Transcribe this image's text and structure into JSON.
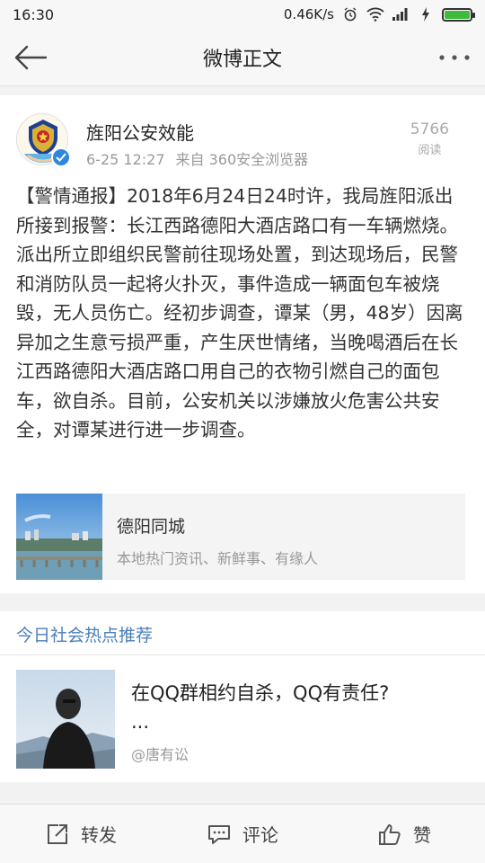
{
  "status_bar": {
    "time": "16:30",
    "net_speed": "0.46K/s",
    "battery_level": 1.0
  },
  "header": {
    "title": "微博正文"
  },
  "post": {
    "author": "旌阳公安效能",
    "date": "6-25 12:27",
    "source": "来自 360安全浏览器",
    "read_count": "5766",
    "read_label": "阅读",
    "text": "【警情通报】2018年6月24日24时许，我局旌阳派出所接到报警：长江西路德阳大酒店路口有一车辆燃烧。派出所立即组织民警前往现场处置，到达现场后，民警和消防队员一起将火扑灭，事件造成一辆面包车被烧毁，无人员伤亡。经初步调查，谭某（男，48岁）因离异加之生意亏损严重，产生厌世情绪，当晚喝酒后在长江西路德阳大酒店路口用自己的衣物引燃自己的面包车，欲自杀。目前，公安机关以涉嫌放火危害公共安全，对谭某进行进一步调查。",
    "link_card": {
      "title": "德阳同城",
      "desc": "本地热门资讯、新鲜事、有缘人"
    }
  },
  "recommend": {
    "header": "今日社会热点推荐",
    "item": {
      "title": "在QQ群相约自杀，QQ有责任?",
      "ellipsis": "...",
      "source": "@唐有讼"
    }
  },
  "toolbar": {
    "repost": "转发",
    "comment": "评论",
    "like": "赞"
  },
  "colors": {
    "link_blue": "#4a7ebb",
    "verified_blue": "#2e86de",
    "battery_green": "#3fba3f"
  }
}
